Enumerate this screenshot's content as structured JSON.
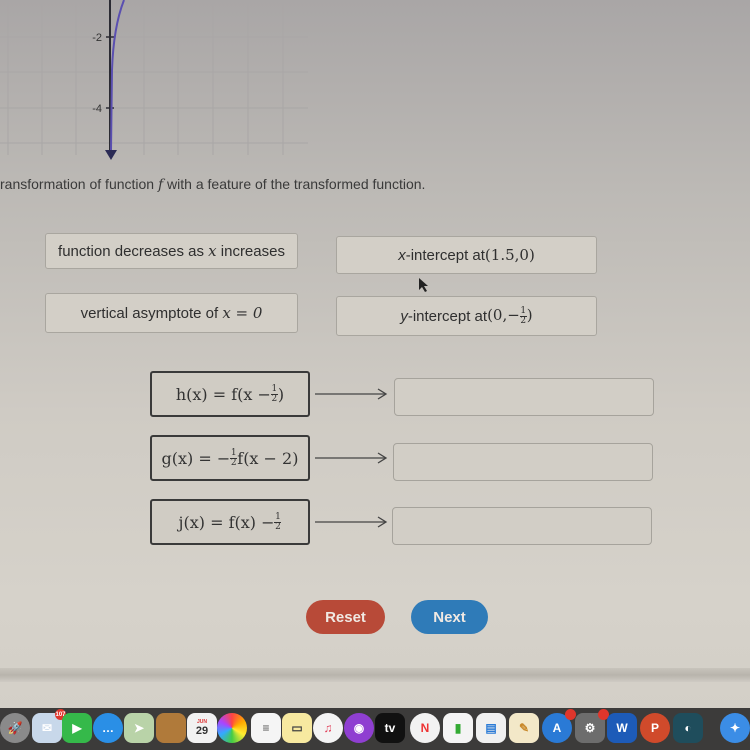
{
  "graph": {
    "y_tick_labels": [
      "-2",
      "-4"
    ],
    "curve_color": "#5a4fb0"
  },
  "instruction": {
    "prefix": "ransformation of function ",
    "f": "f",
    "suffix": " with a feature of the transformed function."
  },
  "tiles": [
    {
      "id": "decreasing",
      "text_before": "function decreases as ",
      "var": "x",
      "text_after": " increases"
    },
    {
      "id": "x-intercept",
      "var": "x",
      "text": "-intercept at ",
      "value": "(1.5,0)"
    },
    {
      "id": "asymptote",
      "text": "vertical asymptote of ",
      "math": "x = 0"
    },
    {
      "id": "y-intercept",
      "var": "y",
      "text": "-intercept at ",
      "value_prefix": "(0,−",
      "frac_num": "1",
      "frac_den": "2",
      "value_suffix": ")"
    }
  ],
  "functions": [
    {
      "name": "h",
      "lhs": "h(x) = f(x − ",
      "frac_num": "1",
      "frac_den": "2",
      "rhs": ")"
    },
    {
      "name": "g",
      "lhs": "g(x) = −",
      "frac_num": "1",
      "frac_den": "2",
      "rhs": "f(x − 2)"
    },
    {
      "name": "j",
      "lhs": "j(x) = f(x) − ",
      "frac_num": "1",
      "frac_den": "2",
      "rhs": ""
    }
  ],
  "buttons": {
    "reset": "Reset",
    "next": "Next"
  },
  "dock": {
    "calendar_day": "29",
    "calendar_month": "JUN",
    "mail_badge": "107",
    "tv_label": "tv",
    "word_label": "W",
    "powerpoint_label": "P"
  }
}
